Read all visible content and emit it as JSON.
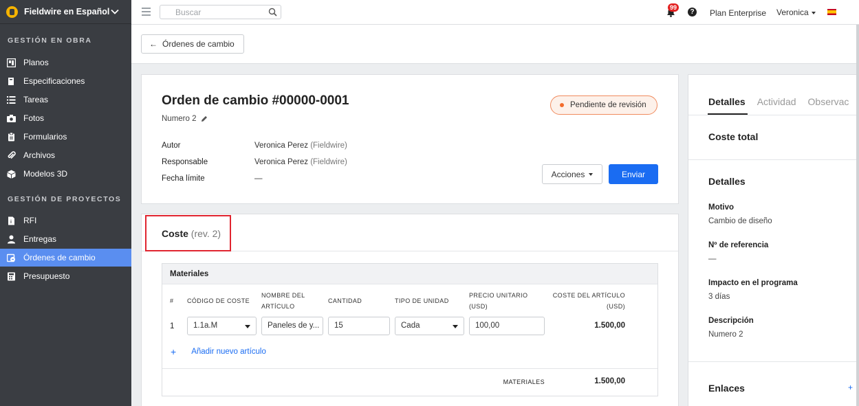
{
  "sidebar": {
    "project": "Fieldwire en Español",
    "section1": "GESTIÓN EN OBRA",
    "section2": "GESTIÓN DE PROYECTOS",
    "items": [
      {
        "label": "Planos"
      },
      {
        "label": "Especificaciones"
      },
      {
        "label": "Tareas"
      },
      {
        "label": "Fotos"
      },
      {
        "label": "Formularios"
      },
      {
        "label": "Archivos"
      },
      {
        "label": "Modelos 3D"
      },
      {
        "label": "RFI"
      },
      {
        "label": "Entregas"
      },
      {
        "label": "Órdenes de cambio"
      },
      {
        "label": "Presupuesto"
      }
    ]
  },
  "topbar": {
    "search_placeholder": "Buscar",
    "notifications": "99",
    "help": "?",
    "plan": "Plan Enterprise",
    "user": "Veronica"
  },
  "back": {
    "label": "Órdenes de cambio"
  },
  "order": {
    "title": "Orden de cambio #00000-0001",
    "subtitle": "Numero 2",
    "status": "Pendiente de revisión",
    "author_label": "Autor",
    "author_name": "Veronica Perez",
    "author_org": "(Fieldwire)",
    "assignee_label": "Responsable",
    "assignee_name": "Veronica Perez",
    "assignee_org": "(Fieldwire)",
    "due_label": "Fecha límite",
    "due_value": "—",
    "actions": "Acciones",
    "send": "Enviar"
  },
  "cost": {
    "title": "Coste",
    "rev": "(rev. 2)",
    "materials": {
      "title": "Materiales",
      "headers": {
        "num": "#",
        "code": "CÓDIGO DE COSTE",
        "name_1": "NOMBRE DEL",
        "name_2": "ARTÍCULO",
        "qty": "CANTIDAD",
        "unit": "TIPO DE UNIDAD",
        "price_1": "PRECIO UNITARIO",
        "price_2": "(USD)",
        "total_1": "COSTE DEL ARTÍCULO",
        "total_2": "(USD)"
      },
      "rows": [
        {
          "num": "1",
          "code": "1.1a.M",
          "name": "Paneles de y...",
          "qty": "15",
          "unit": "Cada",
          "price": "100,00",
          "total": "1.500,00"
        }
      ],
      "add_label": "Añadir nuevo artículo",
      "footer_label": "MATERIALES",
      "footer_total": "1.500,00"
    }
  },
  "right_panel": {
    "tabs": [
      "Detalles",
      "Actividad",
      "Observac"
    ],
    "total_cost_heading": "Coste total",
    "details_heading": "Detalles",
    "fields": [
      {
        "label": "Motivo",
        "value": "Cambio de diseño"
      },
      {
        "label": "Nº de referencia",
        "value": "—"
      },
      {
        "label": "Impacto en el programa",
        "value": "3 días"
      },
      {
        "label": "Descripción",
        "value": "Numero 2"
      }
    ],
    "links_heading": "Enlaces",
    "links_add": "+"
  },
  "colors": {
    "sidebar_bg": "#3a3d42",
    "active_item": "#5a8ef0",
    "primary": "#1a6cf2",
    "status_border": "#f08a5d",
    "highlight_box": "#e0242f"
  }
}
